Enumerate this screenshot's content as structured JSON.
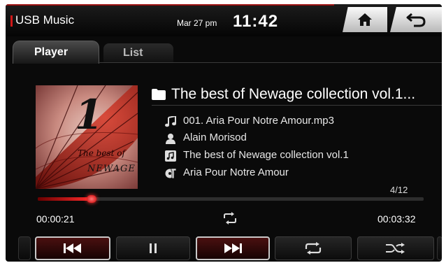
{
  "header": {
    "source_title": "USB Music",
    "date": "Mar 27 pm",
    "time": "11:42"
  },
  "tabs": [
    {
      "label": "Player",
      "active": true
    },
    {
      "label": "List",
      "active": false
    }
  ],
  "album_art": {
    "numeral": "1",
    "caption_line1": "The best of",
    "caption_line2": "NEWAGE"
  },
  "track": {
    "album_title": "The best of Newage collection vol.1...",
    "file_name": "001. Aria Pour Notre Amour.mp3",
    "artist": "Alain Morisod",
    "album": "The best of Newage collection vol.1",
    "song_title": "Aria Pour Notre Amour"
  },
  "playback": {
    "track_counter": "4/12",
    "elapsed": "00:00:21",
    "total": "00:03:32",
    "progress_fraction": 0.14
  },
  "controls": {
    "icons": [
      "skip-previous-icon",
      "pause-icon",
      "skip-next-icon",
      "repeat-icon",
      "shuffle-icon"
    ]
  },
  "colors": {
    "accent": "#d01818",
    "background": "#0a0a0a"
  }
}
